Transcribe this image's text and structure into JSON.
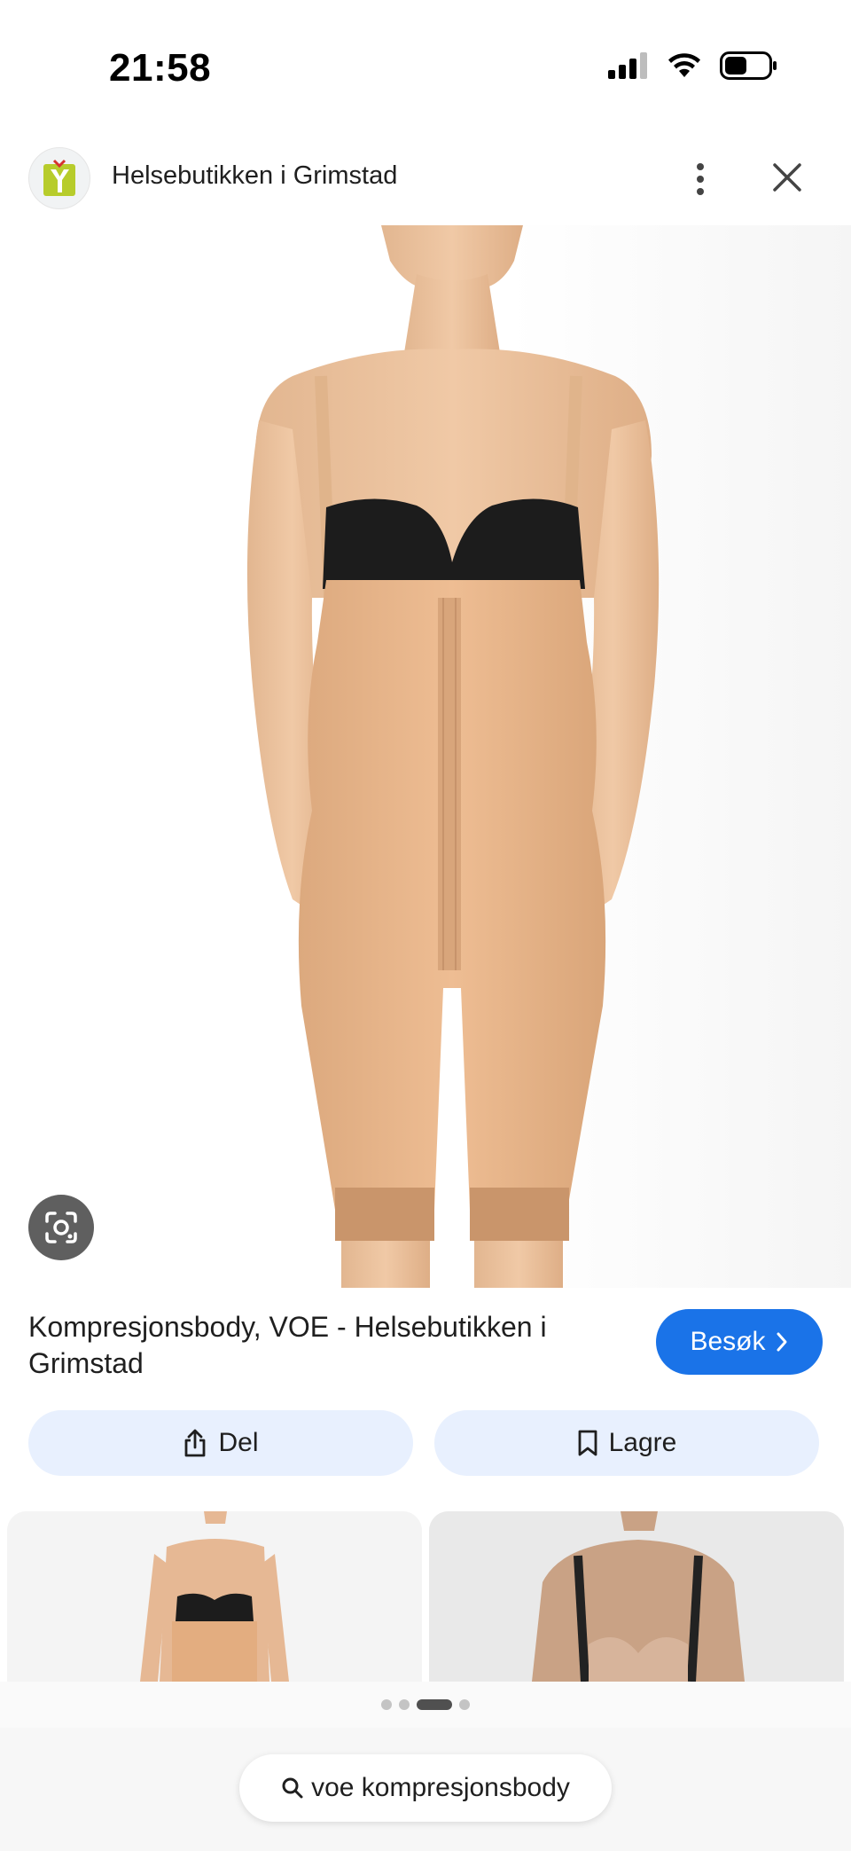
{
  "status": {
    "time": "21:58",
    "icons": [
      "cellular-signal-icon",
      "wifi-icon",
      "battery-icon"
    ]
  },
  "header": {
    "site_name": "Helsebutikken i Grimstad",
    "logo_icon": "site-favicon-icon",
    "more_icon": "more-vertical-icon",
    "close_icon": "close-icon"
  },
  "image": {
    "lens_icon": "lens-search-icon"
  },
  "result": {
    "title": "Kompresjonsbody, VOE - Helsebutikken i Grimstad",
    "visit_label": "Besøk",
    "visit_icon": "chevron-right-icon"
  },
  "actions": {
    "share_label": "Del",
    "share_icon": "share-icon",
    "save_label": "Lagre",
    "save_icon": "bookmark-icon"
  },
  "carousel": {
    "page_count": 4,
    "active_index": 2
  },
  "search": {
    "query": "voe kompresjonsbody",
    "icon": "search-icon"
  },
  "colors": {
    "accent": "#1a73e8",
    "chip_bg": "#e8f0fe",
    "lens_bg": "#5f5f5f",
    "garment": "#e8b78f"
  }
}
